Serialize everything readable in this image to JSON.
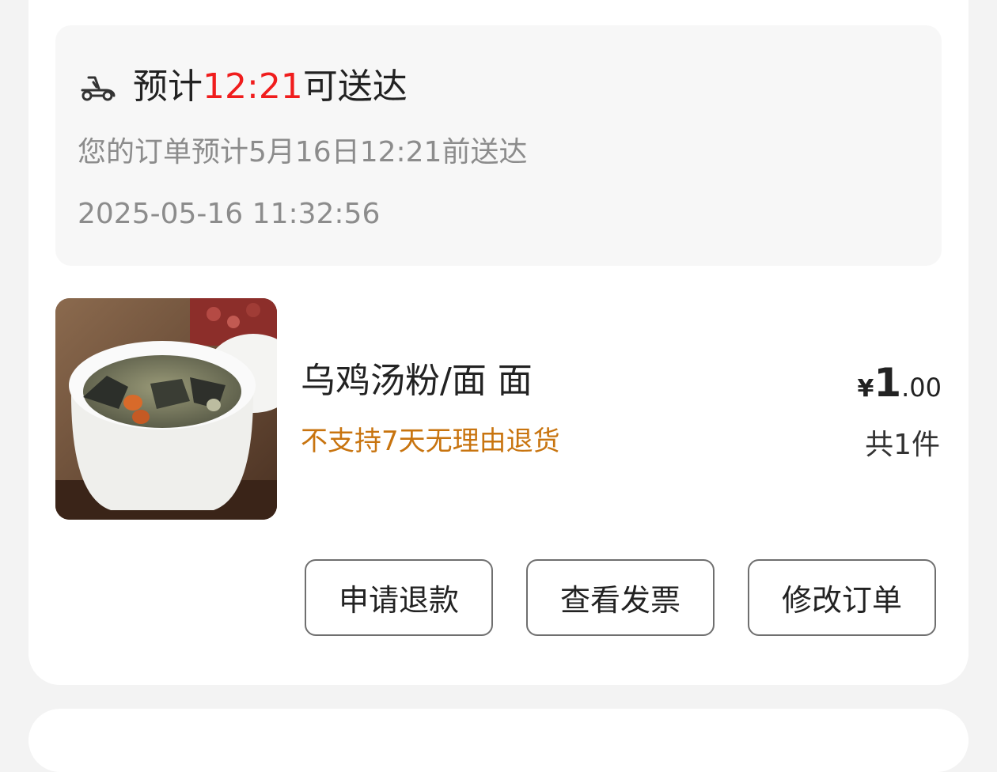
{
  "delivery": {
    "eta_prefix": "预计",
    "eta_time": "12:21",
    "eta_suffix": "可送达",
    "eta_description": "您的订单预计5月16日12:21前送达",
    "order_time": "2025-05-16 11:32:56",
    "icon": "scooter-icon"
  },
  "product": {
    "name": "乌鸡汤粉/面 面",
    "return_policy": "不支持7天无理由退货",
    "price_currency": "¥",
    "price_integer": "1",
    "price_decimal": ".00",
    "quantity": "共1件",
    "image": "chicken-soup-image"
  },
  "actions": {
    "refund": "申请退款",
    "invoice": "查看发票",
    "modify": "修改订单"
  },
  "colors": {
    "eta_time": "#f01d1d",
    "return_policy": "#c8740f",
    "secondary_text": "#8c8c8c"
  }
}
